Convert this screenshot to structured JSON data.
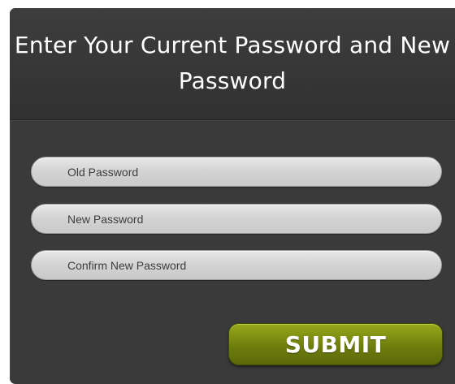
{
  "form": {
    "title": "Enter Your Current Password and New Password",
    "fields": [
      {
        "placeholder": "Old Password",
        "value": ""
      },
      {
        "placeholder": "New Password",
        "value": ""
      },
      {
        "placeholder": "Confirm New Password",
        "value": ""
      }
    ],
    "submit_label": "SUBMIT"
  },
  "colors": {
    "panel_background": "#3a3a3a",
    "field_background": "#d4d4d4",
    "submit_accent": "#7a8b10",
    "title_text": "#ffffff"
  }
}
